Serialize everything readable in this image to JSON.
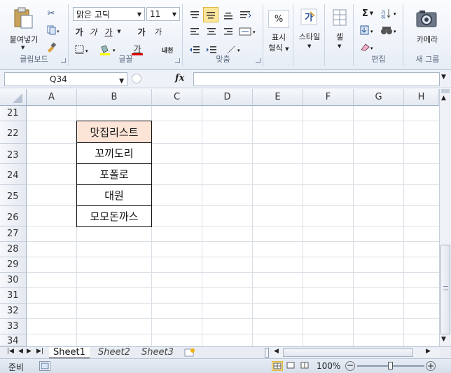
{
  "ribbon": {
    "clipboard": {
      "paste_label": "붙여넣기",
      "group_label": "클립보드"
    },
    "font": {
      "font_name": "맑은 고딕",
      "font_size": "11",
      "bold": "가",
      "italic": "가",
      "underline": "가",
      "grow": "가",
      "shrink": "가",
      "phonetic": "내천",
      "font_color_glyph": "가",
      "group_label": "글꼴"
    },
    "alignment": {
      "group_label": "맞춤"
    },
    "number": {
      "percent": "%",
      "format_label_1": "표시",
      "format_label_2": "형식",
      "style_label": "스타일",
      "group_label": ""
    },
    "cells": {
      "cell_label": "셀"
    },
    "editing": {
      "sum": "Σ",
      "group_label": "편집"
    },
    "camera": {
      "camera_label": "카메라",
      "group_label": "새 그룹"
    }
  },
  "formula_bar": {
    "name_box": "Q34",
    "fx": "fx",
    "value": ""
  },
  "grid": {
    "columns": [
      "A",
      "B",
      "C",
      "D",
      "E",
      "F",
      "G",
      "H"
    ],
    "rows": [
      "21",
      "22",
      "23",
      "24",
      "25",
      "26",
      "27",
      "28",
      "29",
      "30",
      "31",
      "32",
      "33",
      "34"
    ],
    "list_header": "맛집리스트",
    "list_items": [
      "꼬끼도리",
      "포폴로",
      "대원",
      "모모돈까스"
    ],
    "colors": {
      "header_fill": "#fce4d6",
      "border": "#111111"
    }
  },
  "sheets": {
    "tabs": [
      "Sheet1",
      "Sheet2",
      "Sheet3"
    ],
    "active": "Sheet1"
  },
  "status": {
    "ready": "준비",
    "zoom": "100%"
  }
}
